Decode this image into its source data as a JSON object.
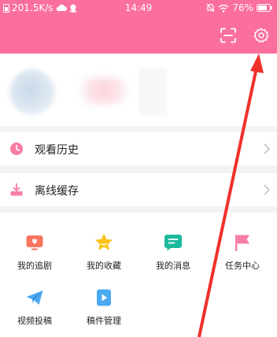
{
  "status_bar": {
    "speed": "201.5K/s",
    "time": "14:49",
    "battery": "76%"
  },
  "header": {
    "scan_icon": "scan-icon",
    "settings_icon": "gear-icon",
    "brand_color": "#fb6f9d"
  },
  "menu": {
    "history_label": "观看历史",
    "offline_label": "离线缓存"
  },
  "grid": {
    "items": [
      {
        "label": "我的追剧",
        "icon": "tv-icon"
      },
      {
        "label": "我的收藏",
        "icon": "star-icon"
      },
      {
        "label": "我的消息",
        "icon": "message-icon"
      },
      {
        "label": "任务中心",
        "icon": "flag-icon"
      },
      {
        "label": "视频投稿",
        "icon": "paper-plane-icon"
      },
      {
        "label": "稿件管理",
        "icon": "video-file-icon"
      }
    ]
  },
  "annotation": {
    "arrow_color": "#f0302a"
  }
}
